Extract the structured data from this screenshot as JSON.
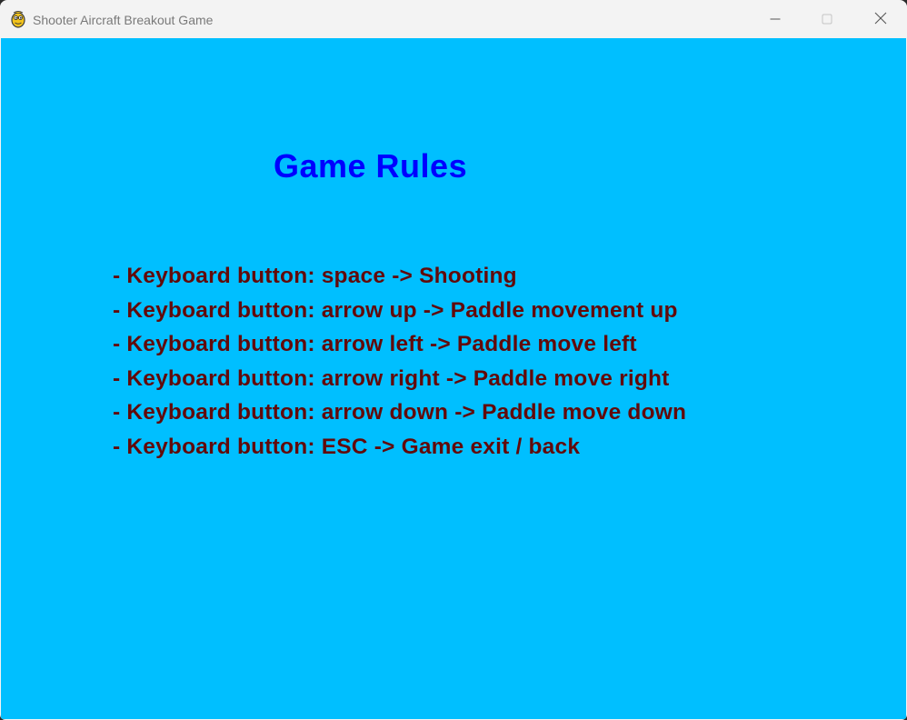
{
  "window": {
    "title": "Shooter Aircraft Breakout Game",
    "icon": "pygame-snake-icon",
    "controls": {
      "minimize_icon": "minimize-icon",
      "maximize_icon": "maximize-icon",
      "close_icon": "close-icon"
    }
  },
  "screen": {
    "background_color": "#00bfff",
    "heading": "Game Rules",
    "heading_color": "#0000ff",
    "rule_color": "#620a0a",
    "rules": [
      "- Keyboard button: space -> Shooting",
      "- Keyboard button: arrow up -> Paddle movement up",
      "- Keyboard button: arrow left -> Paddle move left",
      "- Keyboard button: arrow right -> Paddle move right",
      "- Keyboard button: arrow down -> Paddle move down",
      "- Keyboard button: ESC -> Game exit / back"
    ]
  }
}
